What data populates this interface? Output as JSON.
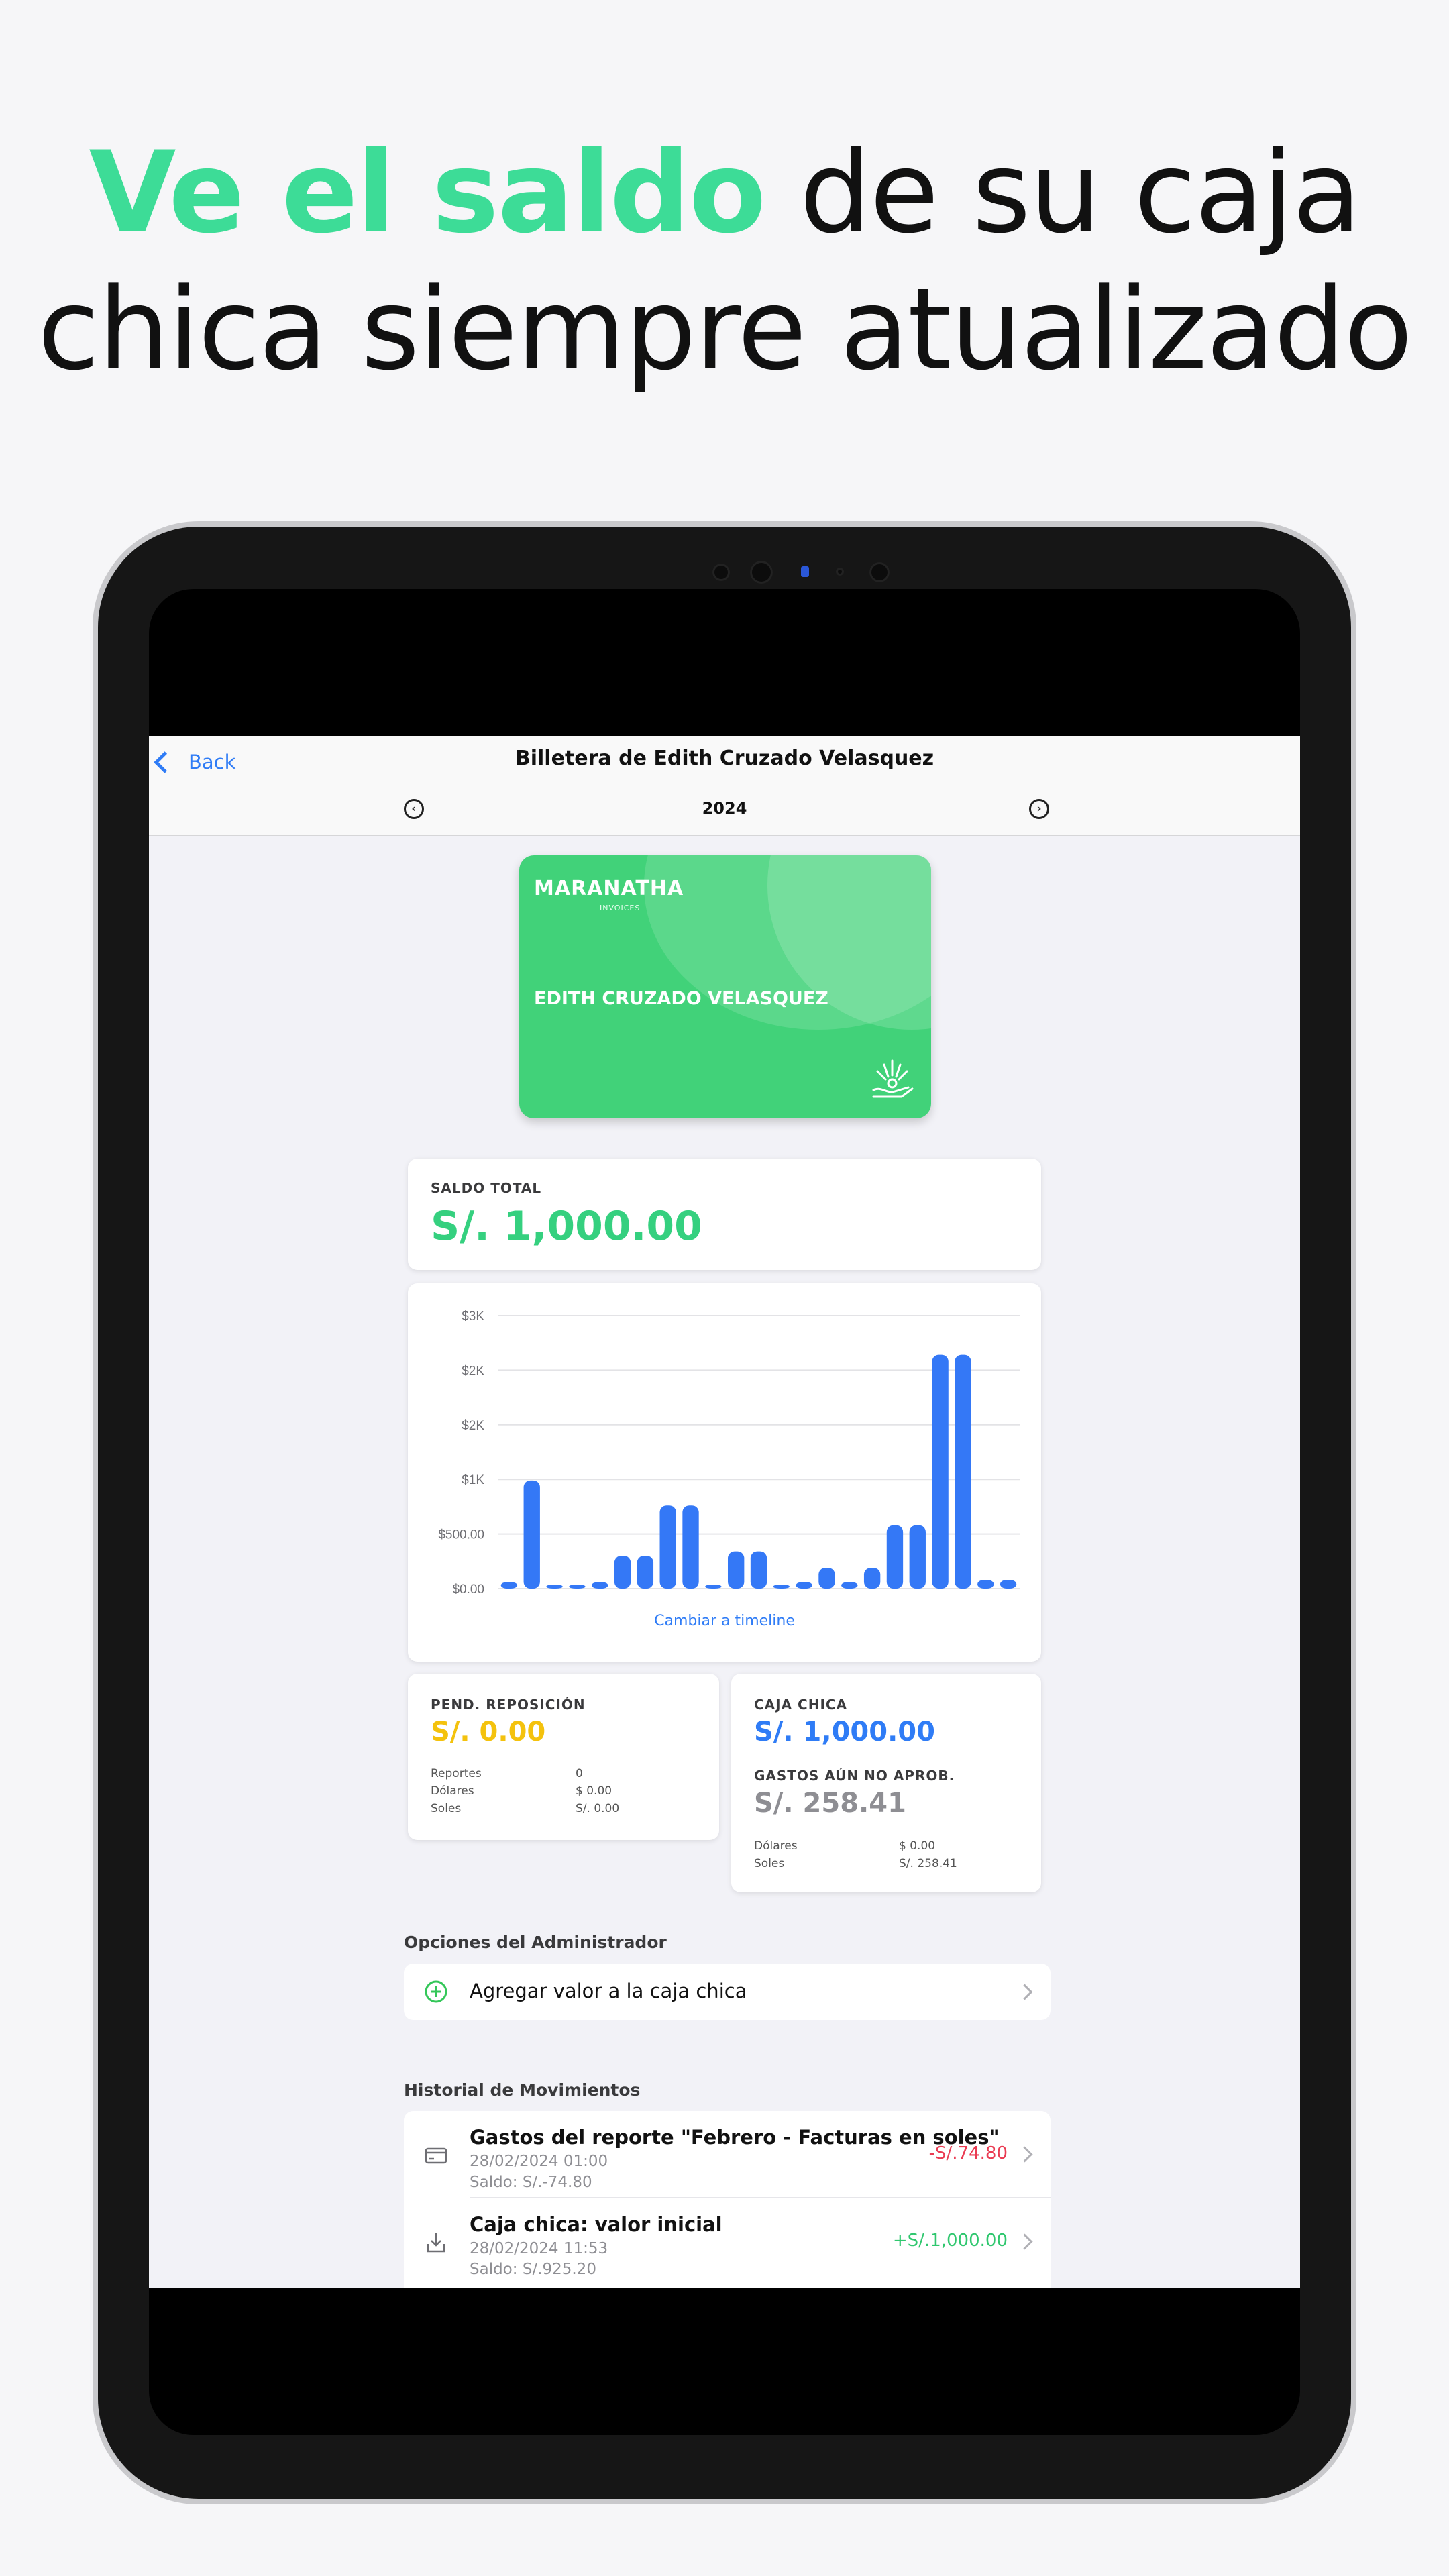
{
  "headline": {
    "accent": "Ve el saldo",
    "line1_rest": " de su caja",
    "line2": "chica siempre atualizado"
  },
  "nav": {
    "back_label": "Back",
    "title": "Billetera de Edith Cruzado Velasquez",
    "year": "2024"
  },
  "card": {
    "brand": "MARANATHA",
    "brand_sub": "INVOICES",
    "holder": "EDITH CRUZADO VELASQUEZ"
  },
  "saldo_total": {
    "label": "SALDO TOTAL",
    "value": "S/. 1,000.00"
  },
  "chart_data": {
    "type": "bar",
    "y_tick_labels": [
      "$0.00",
      "$500.00",
      "$1K",
      "$2K",
      "$2K",
      "$3K"
    ],
    "ylim": [
      0,
      2500
    ],
    "values": [
      60,
      990,
      10,
      10,
      60,
      300,
      300,
      760,
      760,
      30,
      340,
      340,
      30,
      60,
      190,
      60,
      190,
      580,
      580,
      2140,
      2140,
      80,
      80
    ],
    "color": "#3478f6",
    "grid": true,
    "link_label": "Cambiar a timeline"
  },
  "pend": {
    "label": "PEND. REPOSICIÓN",
    "value": "S/. 0.00",
    "value_color": "#f4c20d",
    "rows": [
      {
        "k": "Reportes",
        "v": "0"
      },
      {
        "k": "Dólares",
        "v": "$ 0.00"
      },
      {
        "k": "Soles",
        "v": "S/. 0.00"
      }
    ]
  },
  "caja": {
    "label": "CAJA CHICA",
    "value": "S/. 1,000.00",
    "value_color": "#2f7cf6",
    "gastos_label": "GASTOS AÚN NO APROB.",
    "gastos_value": "S/. 258.41",
    "rows": [
      {
        "k": "Dólares",
        "v": "$ 0.00"
      },
      {
        "k": "Soles",
        "v": "S/. 258.41"
      }
    ]
  },
  "admin": {
    "section_title": "Opciones del Administrador",
    "add_label": "Agregar valor a la caja chica"
  },
  "historial": {
    "section_title": "Historial de Movimientos",
    "items": [
      {
        "icon": "card-icon",
        "title": "Gastos del reporte \"Febrero - Facturas en soles\"",
        "date": "28/02/2024 01:00",
        "saldo": "Saldo: S/.-74.80",
        "amount": "-S/.74.80",
        "amount_color": "#ea3b52"
      },
      {
        "icon": "download-icon",
        "title": "Caja chica: valor inicial",
        "date": "28/02/2024 11:53",
        "saldo": "Saldo: S/.925.20",
        "amount": "+S/.1,000.00",
        "amount_color": "#2fc76e"
      }
    ]
  }
}
